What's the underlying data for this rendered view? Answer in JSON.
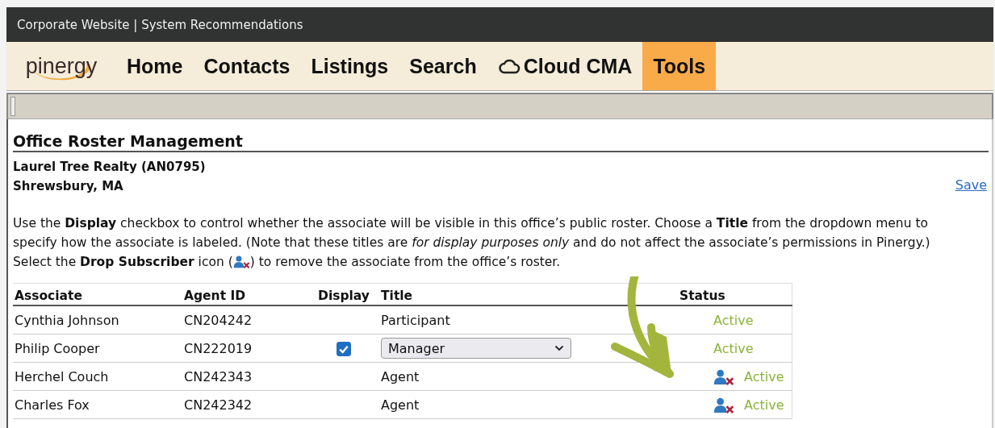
{
  "window": {
    "title": "Corporate Website | System Recommendations"
  },
  "nav": {
    "logo": "pinergy",
    "items": [
      {
        "label": "Home",
        "selected": false,
        "kind": "text"
      },
      {
        "label": "Contacts",
        "selected": false,
        "kind": "text"
      },
      {
        "label": "Listings",
        "selected": false,
        "kind": "text"
      },
      {
        "label": "Search",
        "selected": false,
        "kind": "text"
      },
      {
        "label": "Cloud CMA",
        "selected": false,
        "kind": "cloud"
      },
      {
        "label": "Tools",
        "selected": true,
        "kind": "text"
      }
    ]
  },
  "page": {
    "heading": "Office Roster Management",
    "office": "Laurel Tree Realty (AN0795)",
    "city": "Shrewsbury, MA",
    "save": "Save",
    "instructions_before": "Use the **Display** checkbox to control whether the associate will be visible in this office’s public roster. Choose a **Title** from the dropdown menu to specify how the associate is labeled. (Note that these titles are *for display purposes only* and do not affect the associate’s permissions in Pinergy.) Select the **Drop Subscriber** icon (",
    "instructions_after": ") to remove the associate from the office’s roster."
  },
  "table": {
    "columns": [
      "Associate",
      "Agent ID",
      "Display",
      "Title",
      "Status"
    ],
    "rows": [
      {
        "kind": "readonly",
        "associate": "Cynthia Johnson",
        "agent_id": "CN204242",
        "title": "Participant",
        "status": "Active"
      },
      {
        "kind": "editable",
        "associate": "Philip Cooper",
        "agent_id": "CN222019",
        "display_checked": true,
        "title": "Manager",
        "status": "Active"
      },
      {
        "kind": "removable",
        "associate": "Herchel Couch",
        "agent_id": "CN242343",
        "title": "Agent",
        "status": "Active"
      },
      {
        "kind": "removable",
        "associate": "Charles Fox",
        "agent_id": "CN242342",
        "title": "Agent",
        "status": "Active"
      }
    ]
  }
}
